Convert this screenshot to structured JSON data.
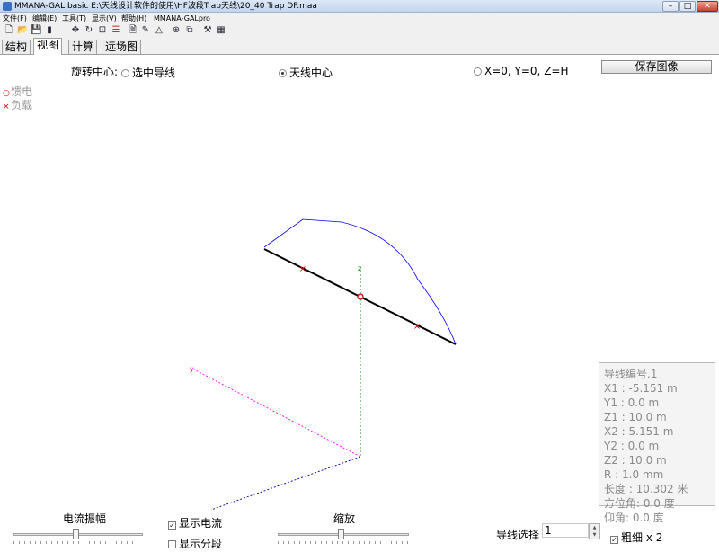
{
  "window": {
    "title": "MMANA-GAL basic  E:\\天线设计软件的使用\\HF波段Trap天线\\20_40 Trap DP.maa",
    "minimize": "–",
    "maximize": "□",
    "close": "✕"
  },
  "menu": {
    "items": [
      "文件(F)",
      "编辑(E)",
      "工具(T)",
      "显示(V)",
      "帮助(H)",
      "MMANA-GALpro"
    ]
  },
  "toolbar": {
    "icons": [
      "new-file-icon",
      "open-folder-icon",
      "save-disk-icon",
      "print-icon",
      "move-icon",
      "rotate-icon",
      "zoom-icon",
      "settings-sliders-icon",
      "document-icon",
      "edit-pencil-icon",
      "triangle-icon",
      "target-icon",
      "copy-icon",
      "tools-icon",
      "calculator-icon"
    ]
  },
  "tabs": [
    "结构",
    "视图",
    "计算",
    "远场图"
  ],
  "view": {
    "rotation_label": "旋转中心:",
    "radio_selected_wire": "选中导线",
    "radio_antenna_center": "天线中心",
    "radio_origin": "X=0, Y=0, Z=H",
    "selected_option": "天线中心",
    "save_image": "保存图像",
    "legend_feed": "馈电",
    "legend_load": "负载",
    "axis_z_label": "z",
    "axis_y_label": "y"
  },
  "wire_info": {
    "number": "导线编号.1",
    "x1": "X1  : -5.151 m",
    "y1": "Y1  : 0.0 m",
    "z1": "Z1  : 10.0 m",
    "x2": "X2  : 5.151 m",
    "y2": "Y2  : 0.0 m",
    "z2": "Z2  : 10.0 m",
    "r": "R   : 1.0 mm",
    "length": "长度 : 10.302 米",
    "azimuth": "方位角: 0.0 度",
    "elevation": "仰角: 0.0 度"
  },
  "controls": {
    "current_amplitude": "电流振幅",
    "show_current": "显示电流",
    "show_current_checked": true,
    "show_segments": "显示分段",
    "show_segments_checked": false,
    "zoom": "缩放",
    "wire_select_label": "导线选择",
    "wire_select_value": "1",
    "thick_label": "粗细 x 2",
    "thick_checked": true,
    "current_slider_fraction": 0.48,
    "zoom_slider_fraction": 0.48
  },
  "colors": {
    "wire": "#000000",
    "current": "#0000ff",
    "axis_z": "#008000",
    "axis_x": "#ff00ff",
    "axis_y": "#0000aa",
    "marker": "#dd0000"
  }
}
